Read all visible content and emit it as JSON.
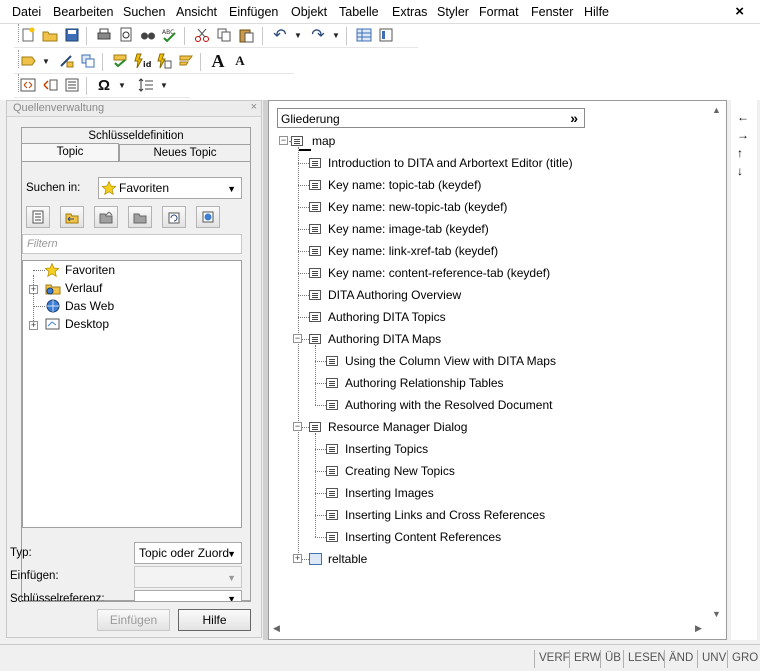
{
  "menu": [
    "Datei",
    "Bearbeiten",
    "Suchen",
    "Ansicht",
    "Einfügen",
    "Objekt",
    "Tabelle",
    "Extras",
    "Styler",
    "Format",
    "Fenster",
    "Hilfe"
  ],
  "window_close": "×",
  "toolbar": {
    "row1_icons": [
      "new-icon",
      "open-icon",
      "save-icon",
      "print-icon",
      "print-preview-icon",
      "find-icon",
      "spellcheck-icon",
      "cut-icon",
      "copy-icon",
      "paste-icon",
      "undo-icon",
      "redo-icon",
      "table-icon",
      "page-layout-icon"
    ],
    "row2_icons": [
      "insert-markup-icon",
      "remove-markup-icon",
      "copy-element-icon",
      "validate-icon",
      "id-icon",
      "insert-link-icon",
      "modify-attr-icon",
      "font-larger-icon",
      "font-smaller-icon"
    ],
    "font_larger": "A",
    "font_smaller": "A",
    "row3_icons": [
      "tag-view-icon",
      "edit-tags-icon",
      "list-icon",
      "special-char-icon",
      "paragraph-spacing-icon"
    ],
    "omega": "Ω"
  },
  "left_panel": {
    "title": "Quellenverwaltung",
    "close": "×",
    "tabs": {
      "keydef": "Schlüsseldefinition",
      "topic": "Topic",
      "new_topic": "Neues Topic"
    },
    "search_in_label": "Suchen in:",
    "search_in_value": "Favoriten",
    "filter_placeholder": "Filtern",
    "tree": [
      {
        "label": "Favoriten",
        "icon": "star-icon",
        "expandable": false
      },
      {
        "label": "Verlauf",
        "icon": "history-icon",
        "expandable": true
      },
      {
        "label": "Das Web",
        "icon": "web-icon",
        "expandable": false
      },
      {
        "label": "Desktop",
        "icon": "desktop-icon",
        "expandable": true
      }
    ],
    "type_label": "Typ:",
    "type_value": "Topic oder Zuord",
    "insert_label": "Einfügen:",
    "insert_value": "",
    "keyref_label": "Schlüsselreferenz:",
    "keyref_value": "",
    "insert_button": "Einfügen",
    "help_button": "Hilfe"
  },
  "outline": {
    "header": "Gliederung",
    "header_chevron": "»",
    "root": "map",
    "items": [
      {
        "label": "Introduction to DITA and Arbortext Editor (title)",
        "level": 1
      },
      {
        "label": "Key name: topic-tab (keydef)",
        "level": 1
      },
      {
        "label": "Key name: new-topic-tab (keydef)",
        "level": 1
      },
      {
        "label": "Key name: image-tab (keydef)",
        "level": 1
      },
      {
        "label": "Key name: link-xref-tab (keydef)",
        "level": 1
      },
      {
        "label": "Key name: content-reference-tab (keydef)",
        "level": 1
      },
      {
        "label": "DITA Authoring Overview",
        "level": 1
      },
      {
        "label": "Authoring DITA Topics",
        "level": 1
      },
      {
        "label": "Authoring DITA Maps",
        "level": 1,
        "expanded": true
      },
      {
        "label": "Using the Column View with DITA Maps",
        "level": 2
      },
      {
        "label": "Authoring Relationship Tables",
        "level": 2
      },
      {
        "label": "Authoring with the Resolved Document",
        "level": 2
      },
      {
        "label": "Resource Manager Dialog",
        "level": 1,
        "expanded": true
      },
      {
        "label": "Inserting Topics",
        "level": 2
      },
      {
        "label": "Creating New Topics",
        "level": 2
      },
      {
        "label": "Inserting Images",
        "level": 2
      },
      {
        "label": "Inserting Links and Cross References",
        "level": 2
      },
      {
        "label": "Inserting Content References",
        "level": 2
      },
      {
        "label": "reltable",
        "level": 1,
        "collapsed": true,
        "icon": "table-icon"
      }
    ]
  },
  "side_tools": [
    "←",
    "→",
    "↑",
    "↓"
  ],
  "status": [
    "VERF",
    "ERW",
    "ÜB",
    "LESEN",
    "ÄND",
    "UNV",
    "GRO"
  ]
}
